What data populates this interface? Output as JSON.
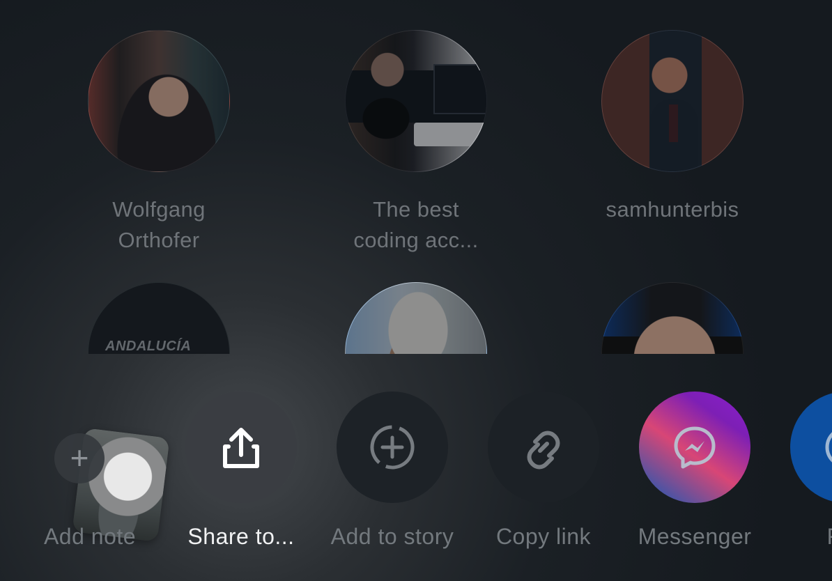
{
  "contacts": [
    {
      "name": "Wolfgang Orthofer"
    },
    {
      "name": "The best coding acc..."
    },
    {
      "name": "samhunterbis"
    },
    {
      "name": "ANDALUCÍA"
    },
    {
      "name": ""
    },
    {
      "name": ""
    }
  ],
  "actions": [
    {
      "label": "Add note",
      "icon": "plus-icon"
    },
    {
      "label": "Share to...",
      "icon": "share-upload-icon",
      "active": true
    },
    {
      "label": "Add to story",
      "icon": "add-story-icon"
    },
    {
      "label": "Copy link",
      "icon": "link-icon"
    },
    {
      "label": "Messenger",
      "icon": "messenger-icon"
    },
    {
      "label": "Fac",
      "icon": "facebook-icon"
    }
  ],
  "colors": {
    "background": "#151a1f",
    "active_label": "#f1f2f3",
    "inactive_label": "#73797e",
    "share_button": "#3a3d42",
    "messenger_gradient_start": "#8b1fcf",
    "messenger_gradient_end": "#e34d86",
    "facebook_blue": "#0d4fa0"
  }
}
